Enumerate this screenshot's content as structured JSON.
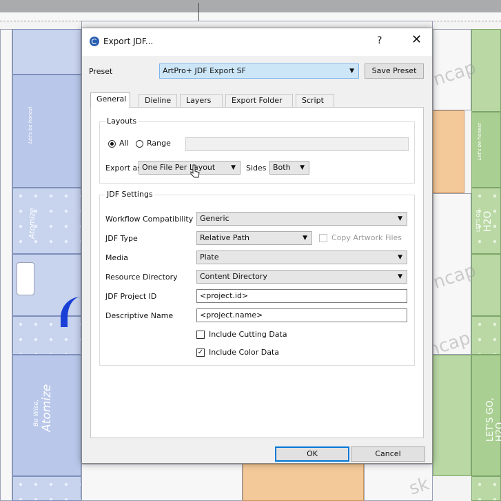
{
  "dialog": {
    "title": "Export JDF...",
    "help_glyph": "?",
    "close_glyph": "✕",
    "preset": {
      "label": "Preset",
      "selected": "ArtPro+ JDF Export SF",
      "save_button": "Save Preset"
    },
    "tabs": [
      "General",
      "Dieline",
      "Layers",
      "Export Folder",
      "Script"
    ],
    "active_tab": "General",
    "layouts": {
      "group_title": "Layouts",
      "all_label": "All",
      "range_label": "Range",
      "selected_mode": "All",
      "range_value": "",
      "export_as_label": "Export as",
      "export_as_value": "One File Per Layout",
      "sides_label": "Sides",
      "sides_value": "Both"
    },
    "jdf_settings": {
      "group_title": "JDF Settings",
      "workflow_label": "Workflow Compatibility",
      "workflow_value": "Generic",
      "jdf_type_label": "JDF Type",
      "jdf_type_value": "Relative Path",
      "copy_artwork_label": "Copy Artwork Files",
      "media_label": "Media",
      "media_value": "Plate",
      "resource_dir_label": "Resource Directory",
      "resource_dir_value": "Content Directory",
      "project_id_label": "JDF Project ID",
      "project_id_value": "<project.id>",
      "descriptive_name_label": "Descriptive Name",
      "descriptive_name_value": "<project.name>",
      "include_cutting_label": "Include Cutting Data",
      "include_cutting_checked": false,
      "include_color_label": "Include Color Data",
      "include_color_checked": true
    },
    "ok_button": "OK",
    "cancel_button": "Cancel"
  },
  "background": {
    "artwork_texts": [
      "Let's be honest",
      "Atomize",
      "Be Wise,",
      "Atomize",
      "Let's be honest",
      "LET'S GO,",
      "H2O",
      "LET'S GO,",
      "H2O"
    ],
    "watermark": "ncap",
    "watermark_bottom": "sk"
  },
  "colors": {
    "dialog_bg": "#f0f0f0",
    "accent": "#0078d7",
    "preset_highlight": "#cde6f7",
    "art_blue": "#c8d3ee",
    "art_green": "#b9d8a4",
    "art_orange": "#f4c99a"
  }
}
